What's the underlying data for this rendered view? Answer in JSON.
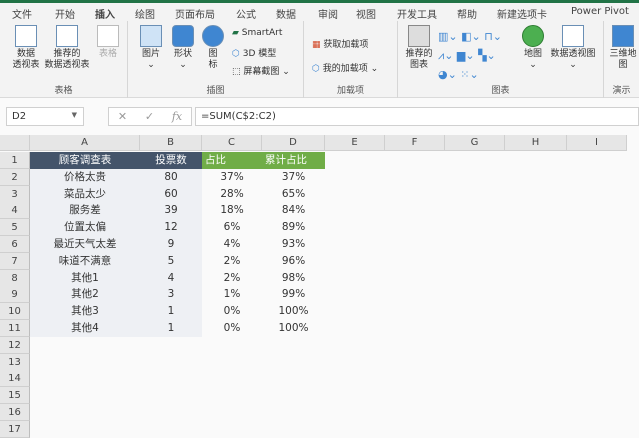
{
  "tabs": [
    "文件",
    "开始",
    "插入",
    "绘图",
    "页面布局",
    "公式",
    "数据",
    "审阅",
    "视图",
    "开发工具",
    "帮助",
    "新建选项卡",
    "Power Pivot"
  ],
  "ribbon": {
    "tables": {
      "label": "表格",
      "pivot": "数据\n透视表",
      "recommended_pivot": "推荐的\n数据透视表",
      "table": "表格"
    },
    "illustrations": {
      "label": "插图",
      "picture": "图片",
      "shapes": "形状",
      "icons": "图\n标",
      "smartart": "SmartArt",
      "model3d": "3D 模型",
      "screenshot": "屏幕截图"
    },
    "addins": {
      "label": "加载项",
      "get": "获取加载项",
      "my": "我的加载项"
    },
    "charts": {
      "label": "图表",
      "recommended": "推荐的\n图表",
      "map": "地图",
      "pivotchart": "数据透视图"
    },
    "tours": {
      "label": "演示",
      "map3d": "三维地\n图"
    }
  },
  "name_box": "D2",
  "formula": "=SUM(C$2:C2)",
  "columns": [
    "A",
    "B",
    "C",
    "D",
    "E",
    "F",
    "G",
    "H",
    "I"
  ],
  "rows": [
    "1",
    "2",
    "3",
    "4",
    "5",
    "6",
    "7",
    "8",
    "9",
    "10",
    "11",
    "12",
    "13",
    "14",
    "15",
    "16",
    "17"
  ],
  "header": [
    "顾客调查表",
    "投票数",
    "占比",
    "累计占比"
  ],
  "data": [
    [
      "价格太贵",
      "80",
      "37%",
      "37%"
    ],
    [
      "菜品太少",
      "60",
      "28%",
      "65%"
    ],
    [
      "服务差",
      "39",
      "18%",
      "84%"
    ],
    [
      "位置太偏",
      "12",
      "6%",
      "89%"
    ],
    [
      "最近天气太差",
      "9",
      "4%",
      "93%"
    ],
    [
      "味道不满意",
      "5",
      "2%",
      "96%"
    ],
    [
      "其他1",
      "4",
      "2%",
      "98%"
    ],
    [
      "其他2",
      "3",
      "1%",
      "99%"
    ],
    [
      "其他3",
      "1",
      "0%",
      "100%"
    ],
    [
      "其他4",
      "1",
      "0%",
      "100%"
    ]
  ]
}
